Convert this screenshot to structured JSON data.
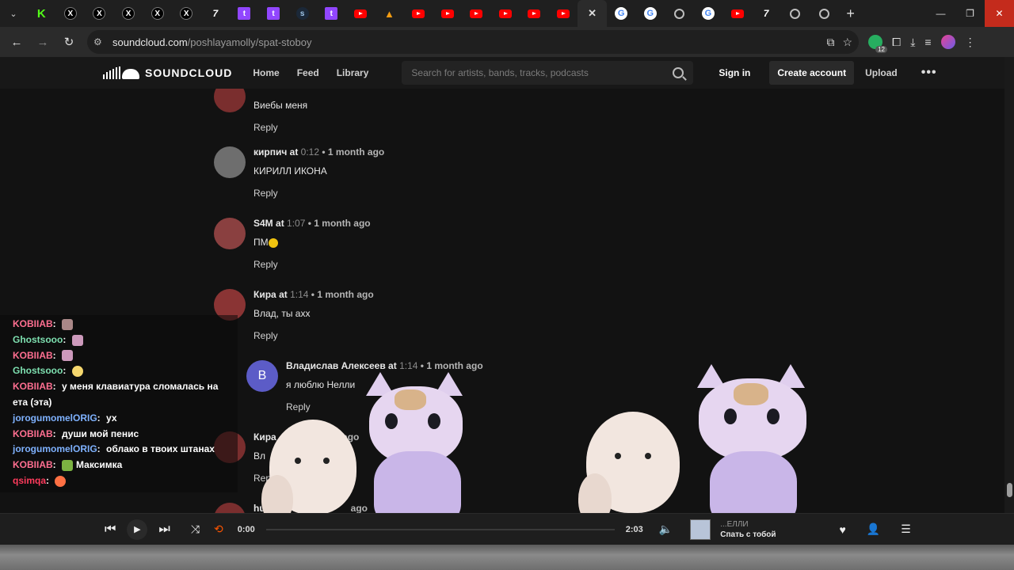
{
  "browser": {
    "tabs": [
      {
        "icon": "kick-icon",
        "glyph": "K",
        "kind": "kick"
      },
      {
        "icon": "x-icon",
        "glyph": "X",
        "kind": "x"
      },
      {
        "icon": "x-icon",
        "glyph": "X",
        "kind": "x"
      },
      {
        "icon": "x-icon",
        "glyph": "X",
        "kind": "x"
      },
      {
        "icon": "x-icon",
        "glyph": "X",
        "kind": "x"
      },
      {
        "icon": "x-icon",
        "glyph": "X",
        "kind": "x"
      },
      {
        "icon": "7tv-icon",
        "glyph": "7",
        "kind": "seven"
      },
      {
        "icon": "twitch-icon",
        "glyph": "t",
        "kind": "twitch"
      },
      {
        "icon": "twitch-icon",
        "glyph": "t",
        "kind": "twitch"
      },
      {
        "icon": "steam-icon",
        "glyph": "s",
        "kind": "steam"
      },
      {
        "icon": "twitch-icon",
        "glyph": "t",
        "kind": "twitch"
      },
      {
        "icon": "youtube-icon",
        "glyph": "",
        "kind": "yt"
      },
      {
        "icon": "vlc-icon",
        "glyph": "▲",
        "kind": "cone"
      },
      {
        "icon": "youtube-icon",
        "glyph": "",
        "kind": "yt"
      },
      {
        "icon": "youtube-icon",
        "glyph": "",
        "kind": "yt"
      },
      {
        "icon": "youtube-icon",
        "glyph": "",
        "kind": "yt"
      },
      {
        "icon": "youtube-icon",
        "glyph": "",
        "kind": "yt"
      },
      {
        "icon": "youtube-icon",
        "glyph": "",
        "kind": "yt"
      },
      {
        "icon": "youtube-icon",
        "glyph": "",
        "kind": "yt"
      },
      {
        "icon": "close-icon",
        "glyph": "✕",
        "kind": "close",
        "active": true
      },
      {
        "icon": "google-icon",
        "glyph": "G",
        "kind": "g"
      },
      {
        "icon": "google-icon",
        "glyph": "G",
        "kind": "g"
      },
      {
        "icon": "globe-icon",
        "glyph": "",
        "kind": "globe"
      },
      {
        "icon": "google-icon",
        "glyph": "G",
        "kind": "g"
      },
      {
        "icon": "youtube-icon",
        "glyph": "",
        "kind": "yt"
      },
      {
        "icon": "7tv-icon",
        "glyph": "7",
        "kind": "seven"
      },
      {
        "icon": "globe-icon",
        "glyph": "",
        "kind": "globe"
      },
      {
        "icon": "globe-icon",
        "glyph": "",
        "kind": "globe"
      }
    ],
    "url_host": "soundcloud.com",
    "url_path": "/poshlayamolly/spat-stoboy",
    "extension_badge": "12"
  },
  "soundcloud": {
    "wordmark": "SOUNDCLOUD",
    "nav": [
      "Home",
      "Feed",
      "Library"
    ],
    "search_placeholder": "Search for artists, bands, tracks, podcasts",
    "sign_in": "Sign in",
    "create_account": "Create account",
    "upload": "Upload",
    "more": "•••"
  },
  "comments": [
    {
      "user": "",
      "at": "",
      "ts": "",
      "ago": "",
      "text": "Виебы меня",
      "reply": "Reply",
      "avatar_color": "#7a2e2e",
      "partial": true
    },
    {
      "user": "кирпич",
      "at": "at",
      "ts": "0:12",
      "ago": "1 month ago",
      "text": "КИРИЛЛ ИКОНА",
      "reply": "Reply",
      "avatar_color": "#6e6e6e"
    },
    {
      "user": "S4M",
      "at": "at",
      "ts": "1:07",
      "ago": "1 month ago",
      "text": "ПМ",
      "emoji": true,
      "reply": "Reply",
      "avatar_color": "#8a4040"
    },
    {
      "user": "Кира",
      "at": "at",
      "ts": "1:14",
      "ago": "1 month ago",
      "text": "Влад, ты ахх",
      "reply": "Reply",
      "avatar_color": "#8a3434"
    },
    {
      "user": "Владислав Алексеев",
      "at": "at",
      "ts": "1:14",
      "ago": "1 month ago",
      "text": "я люблю Нелли",
      "reply": "Reply",
      "avatar_color": "#5c5cc7",
      "avatar_letter": "B",
      "nested": true
    },
    {
      "user": "Кира",
      "at": "",
      "ts": "",
      "ago": "onth ago",
      "text": "Вл",
      "reply": "Repl",
      "avatar_color": "#7a2e2e",
      "partial": true
    },
    {
      "user": "hu",
      "at": "",
      "ts": "",
      "ago": "ago",
      "text": "",
      "reply": "",
      "avatar_color": "#7a2e2e",
      "partial": true
    }
  ],
  "chat": [
    {
      "name": "KOBIIAB",
      "cls": "n1",
      "msg": "",
      "emote": "e1"
    },
    {
      "name": "Ghostsooo",
      "cls": "n2",
      "msg": "",
      "emote": "e2"
    },
    {
      "name": "KOBIIAB",
      "cls": "n1",
      "msg": "",
      "emote": "e2"
    },
    {
      "name": "Ghostsooo",
      "cls": "n2",
      "msg": "",
      "emote": "e3"
    },
    {
      "name": "KOBIIAB",
      "cls": "n1",
      "msg": "у меня клавиатура сломалась на ета (эта)",
      "emote": ""
    },
    {
      "name": "jorogumomelORIG",
      "cls": "n3",
      "msg": "ух",
      "emote": ""
    },
    {
      "name": "KOBIIAB",
      "cls": "n1",
      "msg": "души мой пенис",
      "emote": ""
    },
    {
      "name": "jorogumomelORIG",
      "cls": "n3",
      "msg": "облако в твоих штанах",
      "emote": ""
    },
    {
      "name": "KOBIIAB",
      "cls": "n1",
      "msg": "Максимка",
      "emote": "e4"
    },
    {
      "name": "qsimqa",
      "cls": "n4",
      "msg": "",
      "emote": "e5"
    }
  ],
  "player": {
    "current_time": "0:00",
    "duration": "2:03",
    "artist": "...ЕЛЛИ",
    "title": "Спать с тобой"
  }
}
